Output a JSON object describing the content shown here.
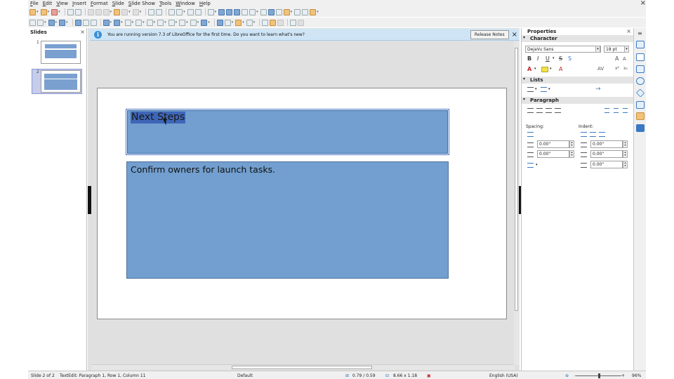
{
  "app": {
    "menu": [
      "File",
      "Edit",
      "View",
      "Insert",
      "Format",
      "Slide",
      "Slide Show",
      "Tools",
      "Window",
      "Help"
    ],
    "window_close": "×"
  },
  "slides_panel": {
    "title": "Slides",
    "close": "×",
    "thumbnails": [
      {
        "number": "1",
        "selected": false
      },
      {
        "number": "2",
        "selected": true
      }
    ]
  },
  "infobar": {
    "icon": "info-icon",
    "message": "You are running version 7.3 of LibreOffice for the first time. Do you want to learn what's new?",
    "button": "Release Notes",
    "close": "×"
  },
  "slide": {
    "title_text": "Next Steps",
    "content_text": "Confirm owners for launch tasks.",
    "box_color": "#729fcf",
    "selection_color": "#3e66b8"
  },
  "properties": {
    "title": "Properties",
    "close": "×",
    "character": {
      "header": "Character",
      "font_name": "DejaVu Sans",
      "font_size": "18 pt",
      "format_buttons": [
        "B",
        "I",
        "U",
        "S",
        "S"
      ]
    },
    "lists": {
      "header": "Lists"
    },
    "paragraph": {
      "header": "Paragraph",
      "spacing_label": "Spacing:",
      "indent_label": "Indent:",
      "spacing_above": "0.00\"",
      "spacing_below": "0.00\"",
      "indent_before": "0.00\"",
      "indent_after": "0.00\"",
      "indent_first": "0.00\""
    }
  },
  "status_bar": {
    "slide_position": "Slide 2 of 2",
    "edit_status": "TextEdit: Paragraph 1, Row 1, Column 11",
    "master": "Default",
    "position": "0.79 / 0.59",
    "size": "8.66 x 1.18",
    "language": "English (USA)",
    "zoom": "96%"
  }
}
